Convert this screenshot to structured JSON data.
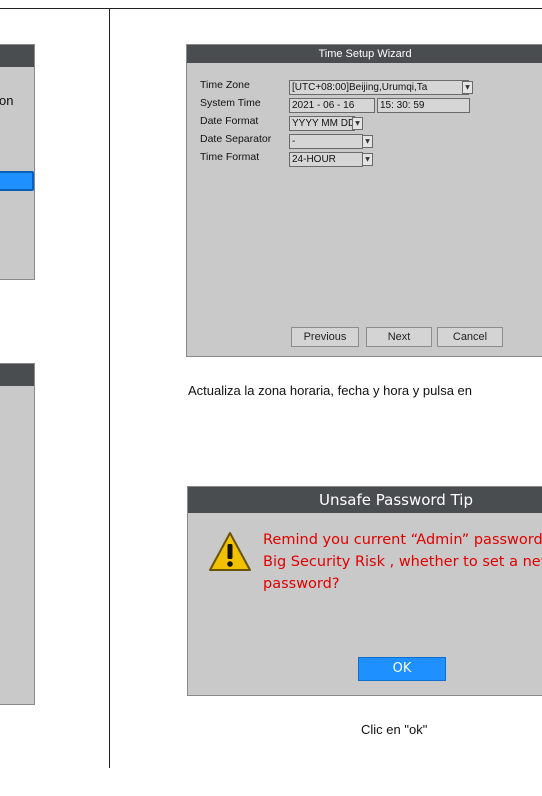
{
  "left_panel_top": {
    "fragment": "on"
  },
  "wizard": {
    "title": "Time Setup Wizard",
    "time_zone": {
      "label": "Time Zone",
      "value": "[UTC+08:00]Beijing,Urumqi,Ta"
    },
    "system_time": {
      "label": "System Time",
      "date": "2021 - 06 - 16",
      "time": "15: 30: 59"
    },
    "date_format": {
      "label": "Date Format",
      "value": "YYYY MM DD"
    },
    "date_separator": {
      "label": "Date Separator",
      "value": "-"
    },
    "time_format": {
      "label": "Time Format",
      "value": "24-HOUR"
    },
    "buttons": {
      "previous": "Previous",
      "next": "Next",
      "cancel": "Cancel"
    }
  },
  "caption1": "Actualiza la zona horaria, fecha y hora y pulsa en",
  "password_tip": {
    "title": "Unsafe Password Tip",
    "message_line1": "Remind you current “Admin” password",
    "message_line2": "Big Security Risk , whether to set a new",
    "message_line3": "password?",
    "ok_label": "OK",
    "warning_icon": "warning-triangle-icon"
  },
  "caption2": "Clic en \"ok\"",
  "colors": {
    "titlebar": "#4a4d50",
    "panel": "#c9c9c9",
    "warning_text": "#e00000",
    "ok_button": "#1e90ff"
  }
}
